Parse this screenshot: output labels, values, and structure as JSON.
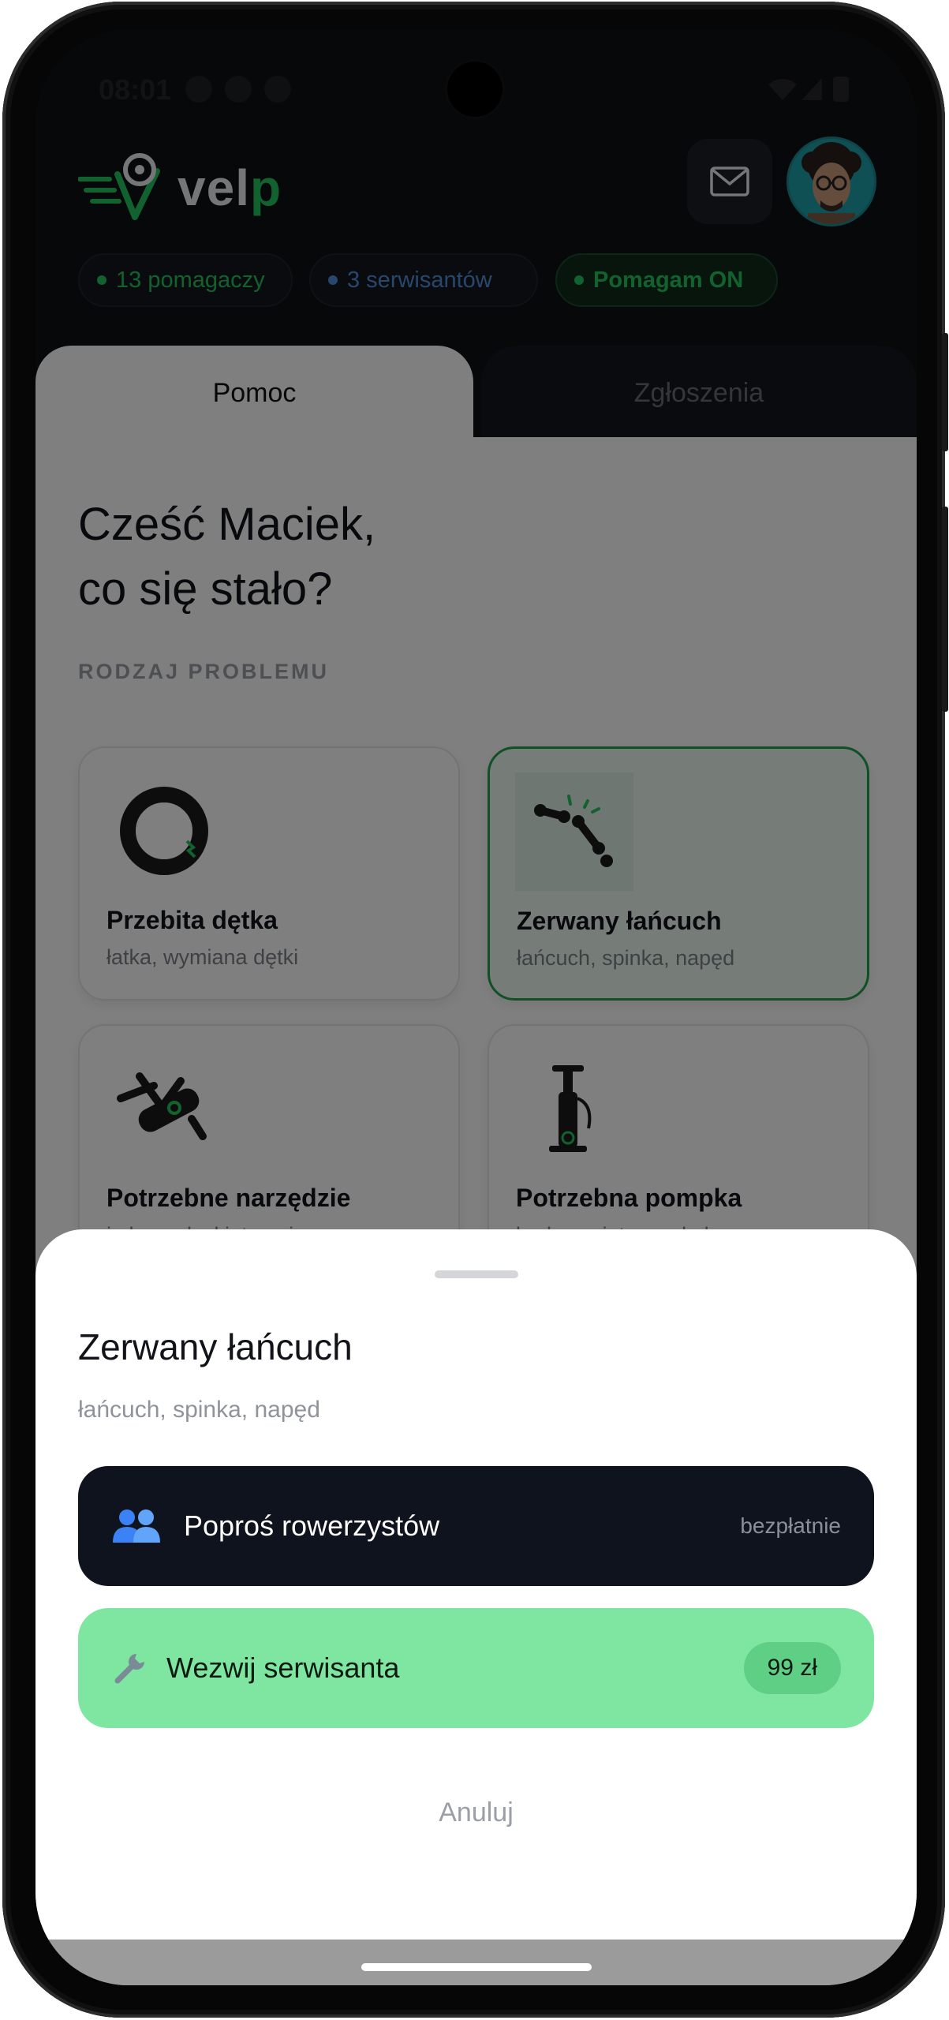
{
  "status_bar": {
    "time": "08:01"
  },
  "header": {
    "logo_text": "vel",
    "logo_accent": "p",
    "stats": [
      {
        "label": "13 pomagaczy",
        "color": "#22c55e"
      },
      {
        "label": "3 serwisantów",
        "color": "#4f8fd8"
      },
      {
        "label": "Pomagam ON",
        "color": "#22c55e"
      }
    ],
    "icons": {
      "mail": "mail-icon",
      "avatar": "user-avatar"
    }
  },
  "tabs": [
    {
      "label": "Pomoc",
      "active": true
    },
    {
      "label": "Zgłoszenia",
      "active": false
    }
  ],
  "main": {
    "greeting_line1": "Cześć Maciek,",
    "greeting_line2": "co się stało?",
    "section_label": "RODZAJ PROBLEMU",
    "problems": [
      {
        "title": "Przebita dętka",
        "subtitle": "łatka, wymiana dętki",
        "icon": "tire-icon",
        "selected": false
      },
      {
        "title": "Zerwany łańcuch",
        "subtitle": "łańcuch, spinka, napęd",
        "icon": "chain-icon",
        "selected": true
      },
      {
        "title": "Potrzebne narzędzie",
        "subtitle": "imbus, płaski, torx, inne",
        "icon": "multitool-icon",
        "selected": false
      },
      {
        "title": "Potrzebna pompka",
        "subtitle": "brak powietrza w kole",
        "icon": "pump-icon",
        "selected": false
      }
    ]
  },
  "sheet": {
    "title": "Zerwany łańcuch",
    "subtitle": "łańcuch, spinka, napęd",
    "ask_cyclists": {
      "label": "Poproś rowerzystów",
      "meta": "bezpłatnie",
      "icon": "people-icon"
    },
    "call_mechanic": {
      "label": "Wezwij serwisanta",
      "price": "99 zł",
      "icon": "wrench-icon"
    },
    "cancel": "Anuluj"
  },
  "colors": {
    "accent": "#22c55e",
    "dark": "#0f131d",
    "green_button": "#7ee6a0"
  }
}
